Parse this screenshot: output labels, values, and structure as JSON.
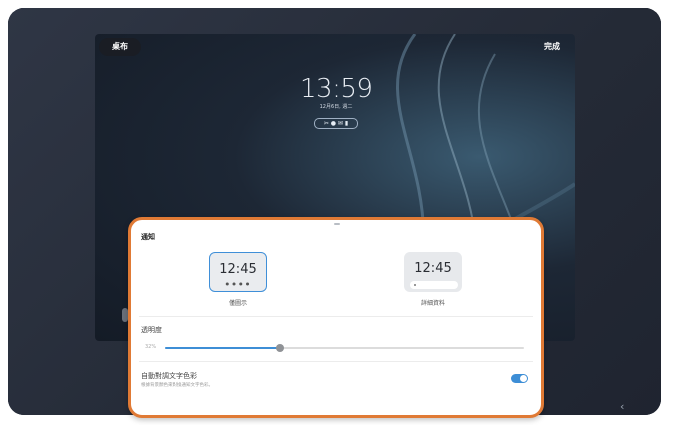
{
  "lockscreen": {
    "left_pill": "桌布",
    "right_pill": "完成",
    "time": "13:59",
    "date": "12月6日, 週二",
    "notification_icons": "✂ ● ✉ ▮"
  },
  "sheet": {
    "title": "通知",
    "options": [
      {
        "time": "12:45",
        "dots": "● ● ● ●",
        "label": "僅圖示",
        "selected": true
      },
      {
        "time": "12:45",
        "label": "詳細資料",
        "selected": false
      }
    ],
    "transparency": {
      "label": "透明度",
      "value_text": "32%",
      "value": 0.32
    },
    "auto_color": {
      "label": "自動對調文字色彩",
      "description": "根據背景顏色來對換通知文字色彩。",
      "enabled": true
    }
  },
  "nav": {
    "back_symbol": "‹"
  },
  "colors": {
    "accent": "#3d8ed6",
    "highlight_border": "#e07a35"
  }
}
